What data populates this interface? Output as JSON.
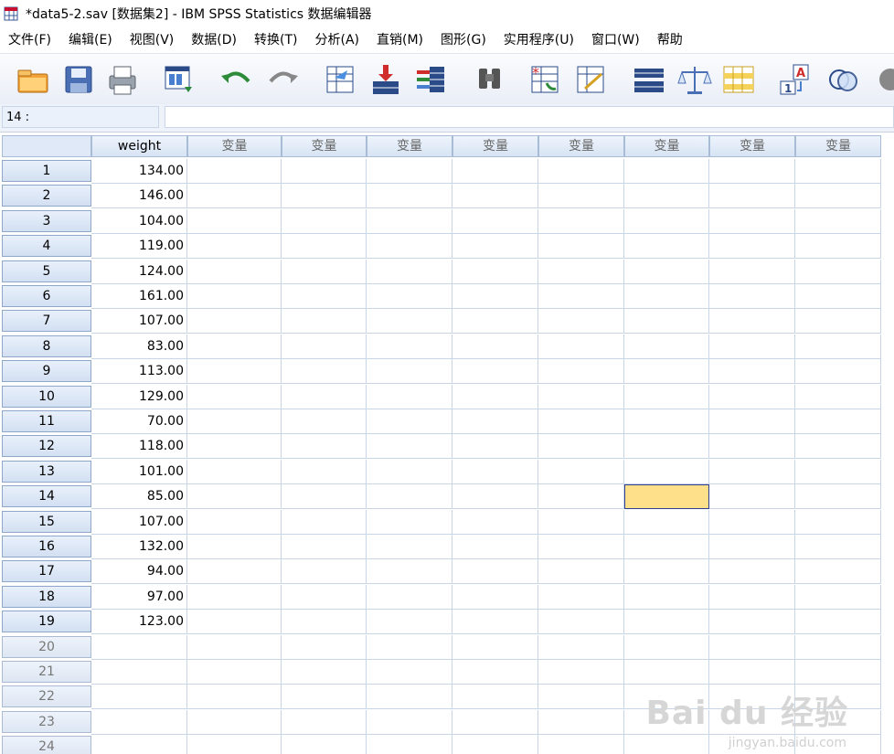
{
  "window": {
    "title": "*data5-2.sav [数据集2] - IBM SPSS Statistics 数据编辑器",
    "icon": "spss-data-editor-icon"
  },
  "menu": [
    {
      "label": "文件(F)"
    },
    {
      "label": "编辑(E)"
    },
    {
      "label": "视图(V)"
    },
    {
      "label": "数据(D)"
    },
    {
      "label": "转换(T)"
    },
    {
      "label": "分析(A)"
    },
    {
      "label": "直销(M)"
    },
    {
      "label": "图形(G)"
    },
    {
      "label": "实用程序(U)"
    },
    {
      "label": "窗口(W)"
    },
    {
      "label": "帮助"
    }
  ],
  "toolbar": [
    {
      "icon": "open-folder-icon"
    },
    {
      "icon": "save-icon"
    },
    {
      "icon": "print-icon"
    },
    {
      "icon": "dialog-recall-icon"
    },
    {
      "icon": "undo-icon"
    },
    {
      "icon": "redo-icon"
    },
    {
      "icon": "goto-case-icon"
    },
    {
      "icon": "goto-variable-icon"
    },
    {
      "icon": "variables-icon"
    },
    {
      "icon": "find-icon"
    },
    {
      "icon": "insert-cases-icon"
    },
    {
      "icon": "insert-variable-icon"
    },
    {
      "icon": "split-file-icon"
    },
    {
      "icon": "weight-cases-icon"
    },
    {
      "icon": "select-cases-icon"
    },
    {
      "icon": "value-labels-icon"
    },
    {
      "icon": "use-sets-icon"
    },
    {
      "icon": "show-all-icon"
    }
  ],
  "cell_editor": {
    "ref": "14 :",
    "value": ""
  },
  "grid": {
    "columns": [
      "weight",
      "变量",
      "变量",
      "变量",
      "变量",
      "变量",
      "变量",
      "变量",
      "变量"
    ],
    "rows": [
      {
        "num": "1",
        "weight": "134.00"
      },
      {
        "num": "2",
        "weight": "146.00"
      },
      {
        "num": "3",
        "weight": "104.00"
      },
      {
        "num": "4",
        "weight": "119.00"
      },
      {
        "num": "5",
        "weight": "124.00"
      },
      {
        "num": "6",
        "weight": "161.00"
      },
      {
        "num": "7",
        "weight": "107.00"
      },
      {
        "num": "8",
        "weight": "83.00"
      },
      {
        "num": "9",
        "weight": "113.00"
      },
      {
        "num": "10",
        "weight": "129.00"
      },
      {
        "num": "11",
        "weight": "70.00"
      },
      {
        "num": "12",
        "weight": "118.00"
      },
      {
        "num": "13",
        "weight": "101.00"
      },
      {
        "num": "14",
        "weight": "85.00"
      },
      {
        "num": "15",
        "weight": "107.00"
      },
      {
        "num": "16",
        "weight": "132.00"
      },
      {
        "num": "17",
        "weight": "94.00"
      },
      {
        "num": "18",
        "weight": "97.00"
      },
      {
        "num": "19",
        "weight": "123.00"
      },
      {
        "num": "20",
        "weight": ""
      },
      {
        "num": "21",
        "weight": ""
      },
      {
        "num": "22",
        "weight": ""
      },
      {
        "num": "23",
        "weight": ""
      },
      {
        "num": "24",
        "weight": ""
      }
    ],
    "active_cell": {
      "row": "14",
      "column": "变量"
    },
    "active_cell_color": "#ffe08a"
  },
  "watermark": {
    "text": "Bai du 经验",
    "sub": "jingyan.baidu.com"
  }
}
